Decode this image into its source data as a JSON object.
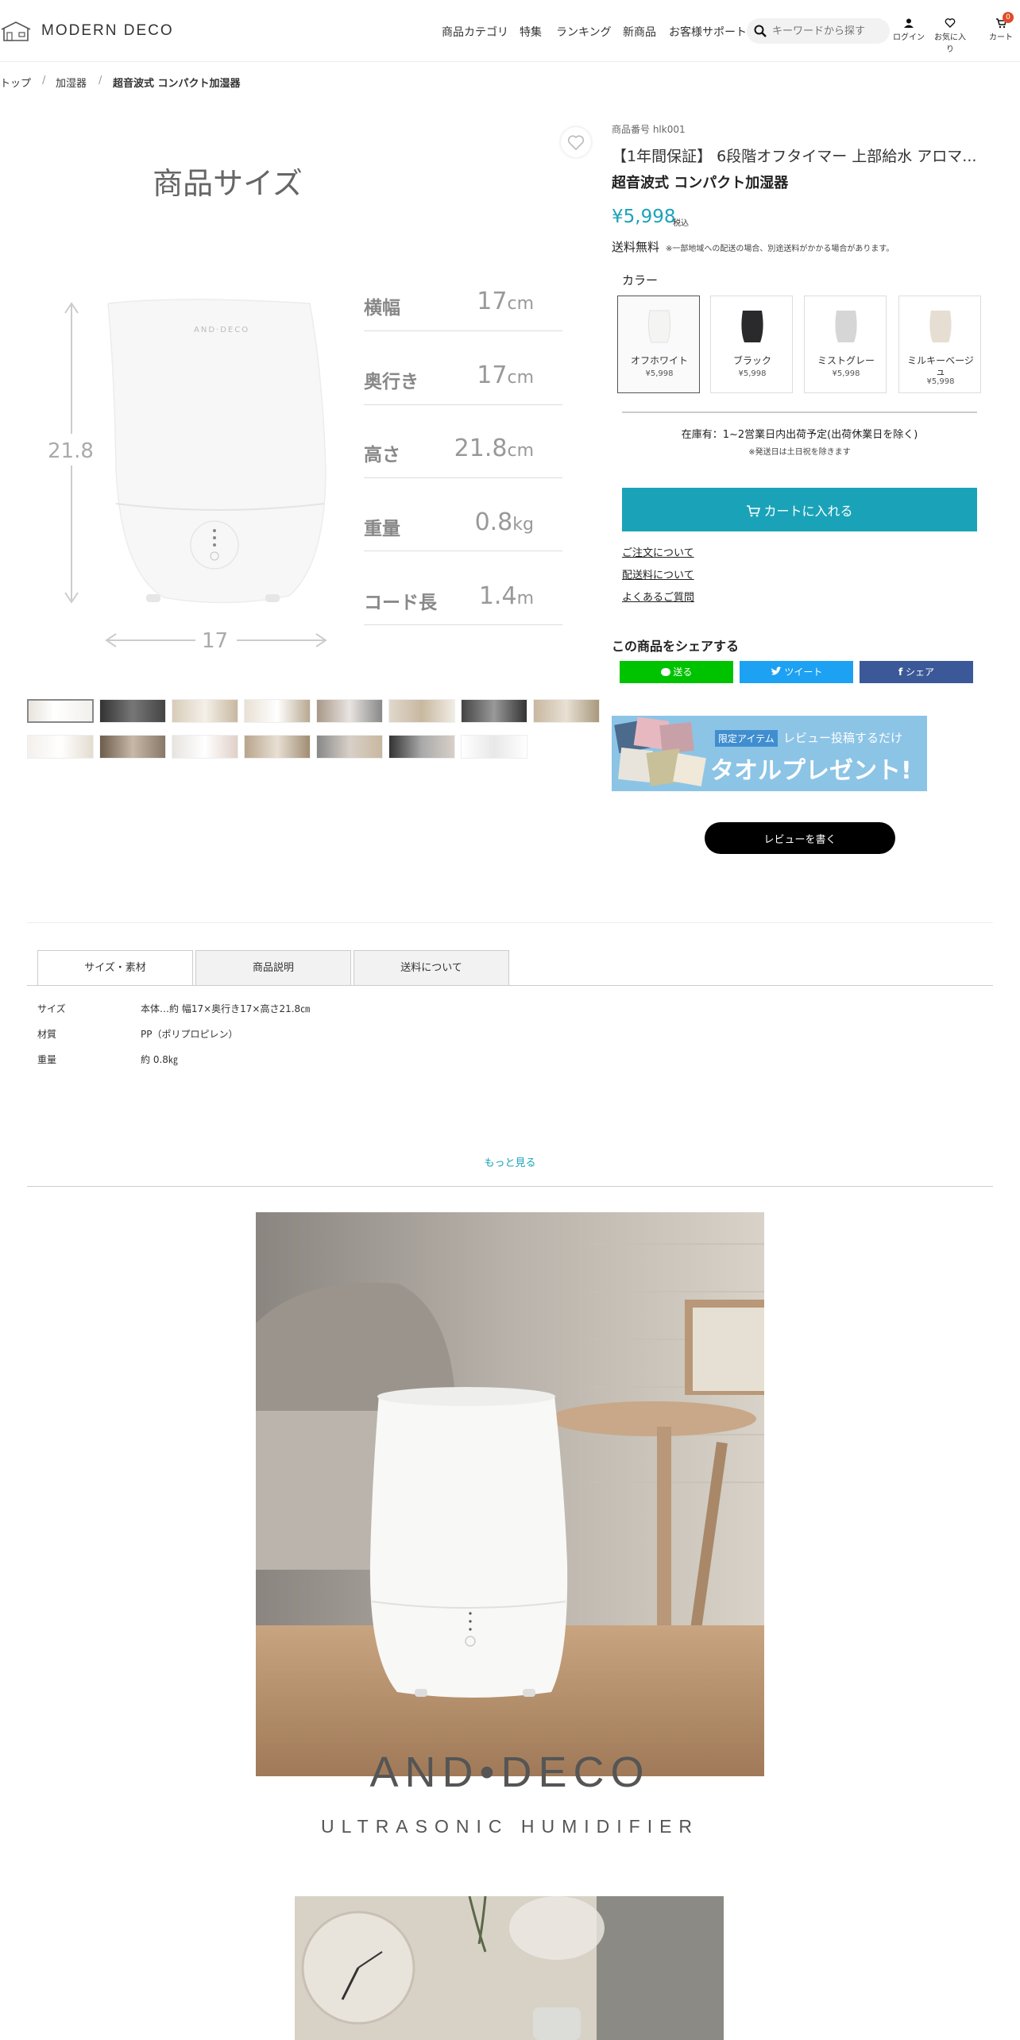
{
  "header": {
    "logo_text": "MODERN DECO",
    "nav": [
      "商品カテゴリ",
      "特集",
      "ランキング",
      "新商品",
      "お客様サポート"
    ],
    "search_placeholder": "キーワードから探す",
    "login_label": "ログイン",
    "favorites_label": "お気に入り",
    "cart_label": "カート",
    "cart_count": "0"
  },
  "breadcrumb": [
    "トップ",
    "加湿器",
    "超音波式 コンパクト加湿器"
  ],
  "gallery": {
    "size_title": "商品サイズ",
    "height_dim": "21.8",
    "width_dim": "17",
    "product_logo": "AND·DECO",
    "specs": [
      {
        "label": "横幅",
        "value": "17",
        "unit": "cm"
      },
      {
        "label": "奥行き",
        "value": "17",
        "unit": "cm"
      },
      {
        "label": "高さ",
        "value": "21.8",
        "unit": "cm"
      },
      {
        "label": "重量",
        "value": "0.8",
        "unit": "kg"
      },
      {
        "label": "コード長",
        "value": "1.4",
        "unit": "m"
      }
    ]
  },
  "product": {
    "number": "商品番号 hlk001",
    "title": "【1年間保証】 6段階オフタイマー 上部給水 アロマ...",
    "subtitle": "超音波式 コンパクト加湿器",
    "price": "¥5,998",
    "tax_label": "税込",
    "shipping": "送料無料",
    "shipping_note": "※一部地域への配送の場合、別途送料がかかる場合があります。",
    "color_label": "カラー",
    "colors": [
      {
        "name": "オフホワイト",
        "price": "¥5,998",
        "swatch": "#f4f4f2"
      },
      {
        "name": "ブラック",
        "price": "¥5,998",
        "swatch": "#2a2a2c"
      },
      {
        "name": "ミストグレー",
        "price": "¥5,998",
        "swatch": "#d6d6d6"
      },
      {
        "name": "ミルキーベージュ",
        "price": "¥5,998",
        "swatch": "#e6ded2"
      }
    ],
    "stock": "在庫有：1~2営業日内出荷予定(出荷休業日を除く)",
    "stock_note": "※発送日は土日祝を除きます",
    "cart_button": "カートに入れる",
    "links": [
      "ご注文について",
      "配送料について",
      "よくあるご質問"
    ],
    "share_title": "この商品をシェアする",
    "share_buttons": [
      "送る",
      "ツイート",
      "シェア"
    ],
    "banner_tag": "限定アイテム",
    "banner_line1": "レビュー投稿するだけ",
    "banner_line2": "タオルプレゼント!",
    "review_button": "レビューを書く"
  },
  "colors": {
    "accent": "#1aa3b8",
    "line": "#00c300",
    "twitter": "#1da1f2",
    "facebook": "#3b5998"
  },
  "tabs": [
    "サイズ・素材",
    "商品説明",
    "送料について"
  ],
  "details": [
    {
      "key": "サイズ",
      "value": "本体…約 幅17×奥行き17×高さ21.8㎝"
    },
    {
      "key": "材質",
      "value": "PP（ポリプロピレン）"
    },
    {
      "key": "重量",
      "value": "約 0.8㎏"
    }
  ],
  "more_label": "もっと見る",
  "feature": {
    "brand": "AND•DECO",
    "subtitle": "ULTRASONIC HUMIDIFIER"
  }
}
